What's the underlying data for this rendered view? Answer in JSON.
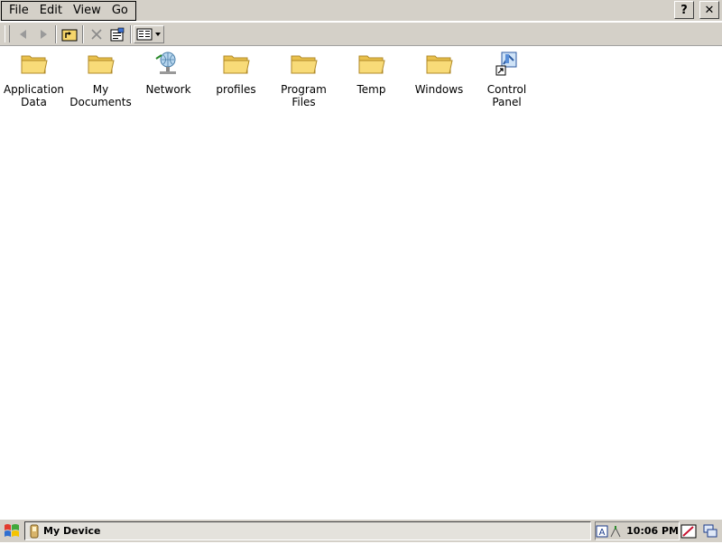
{
  "menubar": {
    "items": [
      {
        "label": "File"
      },
      {
        "label": "Edit"
      },
      {
        "label": "View"
      },
      {
        "label": "Go"
      }
    ],
    "help_label": "?",
    "close_label": "✕"
  },
  "toolbar": {
    "buttons": [
      "back-icon",
      "forward-icon",
      "up-folder-icon",
      "delete-icon",
      "properties-icon",
      "views-icon"
    ]
  },
  "items": [
    {
      "label": "Application Data",
      "icon": "folder-icon"
    },
    {
      "label": "My Documents",
      "icon": "folder-icon"
    },
    {
      "label": "Network",
      "icon": "network-icon"
    },
    {
      "label": "profiles",
      "icon": "folder-icon"
    },
    {
      "label": "Program Files",
      "icon": "folder-icon"
    },
    {
      "label": "Temp",
      "icon": "folder-icon"
    },
    {
      "label": "Windows",
      "icon": "folder-icon"
    },
    {
      "label": "Control Panel",
      "icon": "control-panel-shortcut-icon"
    }
  ],
  "taskbar": {
    "task_label": "My Device",
    "clock": "10:06 PM"
  },
  "colors": {
    "chrome": "#d4d0c8",
    "folder": "#f6d66b",
    "folder_dark": "#c9a23a"
  }
}
